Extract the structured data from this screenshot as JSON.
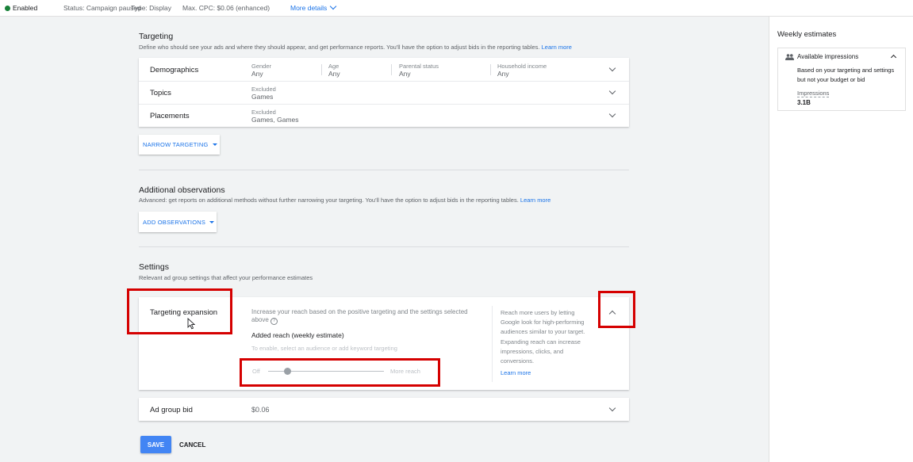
{
  "topbar": {
    "enabled": "Enabled",
    "status": "Status: Campaign paused",
    "type": "Type: Display",
    "max_cpc": "Max. CPC: $0.06 (enhanced)",
    "more_details": "More details"
  },
  "targeting": {
    "title": "Targeting",
    "description": "Define who should see your ads and where they should appear, and get performance reports. You'll have the option to adjust bids in the reporting tables.",
    "learn_more": "Learn more",
    "rows": [
      {
        "label": "Demographics",
        "fields": [
          {
            "label": "Gender",
            "value": "Any"
          },
          {
            "label": "Age",
            "value": "Any"
          },
          {
            "label": "Parental status",
            "value": "Any"
          },
          {
            "label": "Household income",
            "value": "Any"
          }
        ]
      },
      {
        "label": "Topics",
        "fields": [
          {
            "label": "Excluded",
            "value": "Games"
          }
        ]
      },
      {
        "label": "Placements",
        "fields": [
          {
            "label": "Excluded",
            "value": "Games, Games"
          }
        ]
      }
    ],
    "narrow_button": "NARROW TARGETING"
  },
  "observations": {
    "title": "Additional observations",
    "description": "Advanced: get reports on additional methods without further narrowing your targeting. You'll have the option to adjust bids in the reporting tables.",
    "learn_more": "Learn more",
    "add_button": "ADD OBSERVATIONS"
  },
  "settings": {
    "title": "Settings",
    "description": "Relevant ad group settings that affect your performance estimates",
    "expansion": {
      "label": "Targeting expansion",
      "description": "Increase your reach based on the positive targeting and the settings selected above",
      "added_reach": "Added reach (weekly estimate)",
      "hint": "To enable, select an audience or add keyword targeting",
      "slider_min": "Off",
      "slider_max": "More reach",
      "slider_level": 0.17,
      "side_text": "Reach more users by letting Google look for high-performing audiences similar to your target. Expanding reach can increase impressions, clicks, and conversions.",
      "learn_more": "Learn more"
    },
    "bid": {
      "label": "Ad group bid",
      "value": "$0.06"
    }
  },
  "actions": {
    "save": "SAVE",
    "cancel": "CANCEL"
  },
  "weekly": {
    "title": "Weekly estimates",
    "card_title": "Available impressions",
    "card_desc": "Based on your targeting and settings but not your budget or bid",
    "metric_label": "Impressions",
    "metric_value": "3.1B"
  },
  "colors": {
    "accent": "#1a73e8",
    "save_button": "#4285f4",
    "enabled_dot": "#188038",
    "highlight": "#d50000"
  }
}
